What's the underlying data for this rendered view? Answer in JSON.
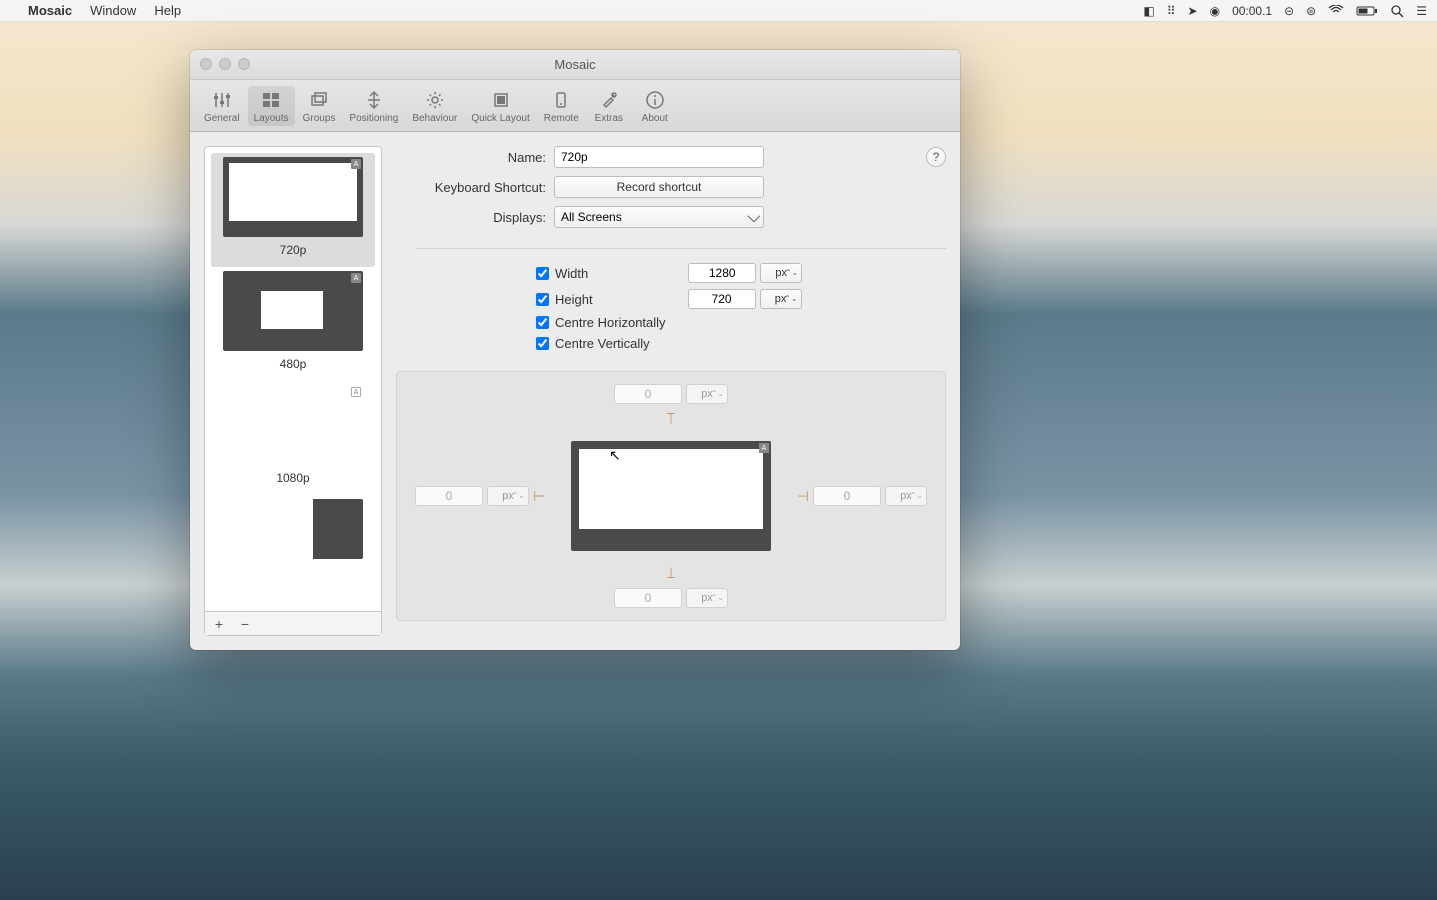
{
  "menubar": {
    "app": "Mosaic",
    "items": [
      "Window",
      "Help"
    ],
    "status_time": "00:00.1"
  },
  "window": {
    "title": "Mosaic"
  },
  "toolbar": {
    "items": [
      {
        "label": "General"
      },
      {
        "label": "Layouts"
      },
      {
        "label": "Groups"
      },
      {
        "label": "Positioning"
      },
      {
        "label": "Behaviour"
      },
      {
        "label": "Quick Layout"
      },
      {
        "label": "Remote"
      },
      {
        "label": "Extras"
      },
      {
        "label": "About"
      }
    ],
    "selected": 1
  },
  "sidebar": {
    "layouts": [
      {
        "name": "720p"
      },
      {
        "name": "480p"
      },
      {
        "name": "1080p"
      },
      {
        "name": ""
      }
    ],
    "add": "+",
    "remove": "−"
  },
  "form": {
    "name_label": "Name:",
    "name_value": "720p",
    "shortcut_label": "Keyboard Shortcut:",
    "shortcut_btn": "Record shortcut",
    "displays_label": "Displays:",
    "displays_value": "All Screens",
    "help": "?"
  },
  "dims": {
    "width_label": "Width",
    "width_value": "1280",
    "width_unit": "px",
    "height_label": "Height",
    "height_value": "720",
    "height_unit": "px",
    "centre_h": "Centre Horizontally",
    "centre_v": "Centre Vertically"
  },
  "margins": {
    "top_value": "0",
    "top_unit": "px",
    "bottom_value": "0",
    "bottom_unit": "px",
    "left_value": "0",
    "left_unit": "px",
    "right_value": "0",
    "right_unit": "px"
  }
}
